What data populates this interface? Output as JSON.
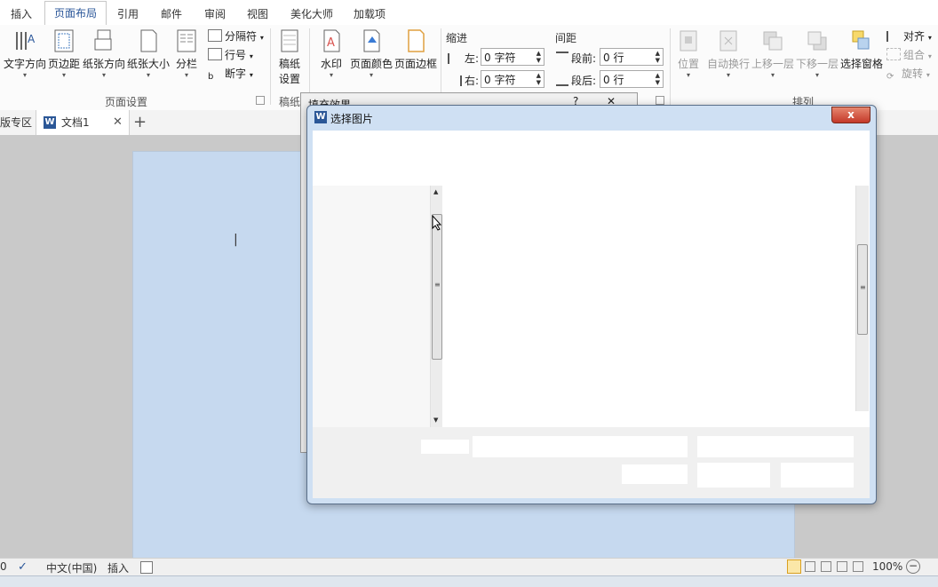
{
  "tabs": [
    "插入",
    "页面布局",
    "引用",
    "邮件",
    "审阅",
    "视图",
    "美化大师",
    "加载项"
  ],
  "active_tab": "页面布局",
  "ribbon": {
    "text_direction": "文字方向",
    "margins": "页边距",
    "orientation": "纸张方向",
    "size": "纸张大小",
    "columns": "分栏",
    "breaks": "分隔符",
    "line_numbers": "行号",
    "hyphenation": "断字",
    "group_page_setup": "页面设置",
    "manuscript_line1": "稿纸",
    "manuscript_line2": "设置",
    "group_manuscript": "稿纸",
    "watermark": "水印",
    "page_color": "页面颜色",
    "page_borders": "页面边框",
    "indent": "缩进",
    "indent_left_label": "左:",
    "indent_left_value": "0 字符",
    "indent_right_label": "右:",
    "indent_right_value": "0 字符",
    "spacing": "间距",
    "before_label": "段前:",
    "before_value": "0 行",
    "after_label": "段后:",
    "after_value": "0 行",
    "position": "位置",
    "wrap_text": "自动换行",
    "bring_forward": "上移一层",
    "send_backward": "下移一层",
    "selection_pane": "选择窗格",
    "align": "对齐",
    "group": "组合",
    "rotate": "旋转",
    "group_arrange": "排列"
  },
  "doc_tabs": {
    "left_partial": "版专区",
    "doc_name": "文档1",
    "add": "+"
  },
  "behind_dialog": {
    "title": "填充效果",
    "help": "?",
    "close": "✕"
  },
  "dialog": {
    "title": "选择图片",
    "close": "x",
    "app_icon": "W"
  },
  "status": {
    "page": "0",
    "language": "中文(中国)",
    "mode": "插入",
    "zoom": "100%"
  }
}
